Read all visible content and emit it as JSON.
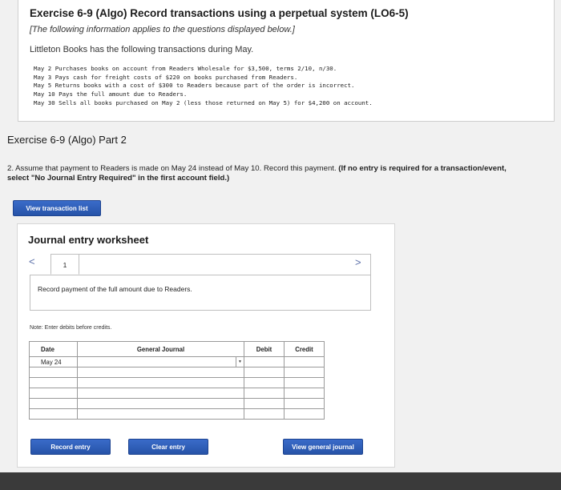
{
  "exercise": {
    "title": "Exercise 6-9 (Algo) Record transactions using a perpetual system (LO6-5)",
    "subtitle": "[The following information applies to the questions displayed below.]",
    "intro": "Littleton Books has the following transactions during May.",
    "transactions": [
      "May 2 Purchases books on account from Readers Wholesale for $3,500, terms 2/10, n/30.",
      "May 3 Pays cash for freight costs of $220 on books purchased from Readers.",
      "May 5 Returns books with a cost of $300 to Readers because part of the order is incorrect.",
      "May 10 Pays the full amount due to Readers.",
      "May 30 Sells all books purchased on May 2 (less those returned on May 5) for $4,200 on account."
    ]
  },
  "part": {
    "title": "Exercise 6-9 (Algo) Part 2",
    "question_main": "2. Assume that payment to Readers is made on May 24 instead of May 10. Record this payment.",
    "question_bold": "(If no entry is required for a transaction/event, select \"No Journal Entry Required\" in the first account field.)",
    "view_transaction_list": "View transaction list"
  },
  "worksheet": {
    "title": "Journal entry worksheet",
    "page_number": "1",
    "prev": "<",
    "next": ">",
    "description": "Record payment of the full amount due to Readers.",
    "note": "Note: Enter debits before credits.",
    "columns": {
      "date": "Date",
      "account": "General Journal",
      "debit": "Debit",
      "credit": "Credit"
    },
    "rows": [
      {
        "date": "May 24"
      },
      {
        "date": ""
      },
      {
        "date": ""
      },
      {
        "date": ""
      },
      {
        "date": ""
      },
      {
        "date": ""
      }
    ],
    "buttons": {
      "record": "Record entry",
      "clear": "Clear entry",
      "view_general_journal": "View general journal"
    }
  },
  "colors": {
    "button": "#2f5fbd",
    "background": "#f1f1f1"
  }
}
